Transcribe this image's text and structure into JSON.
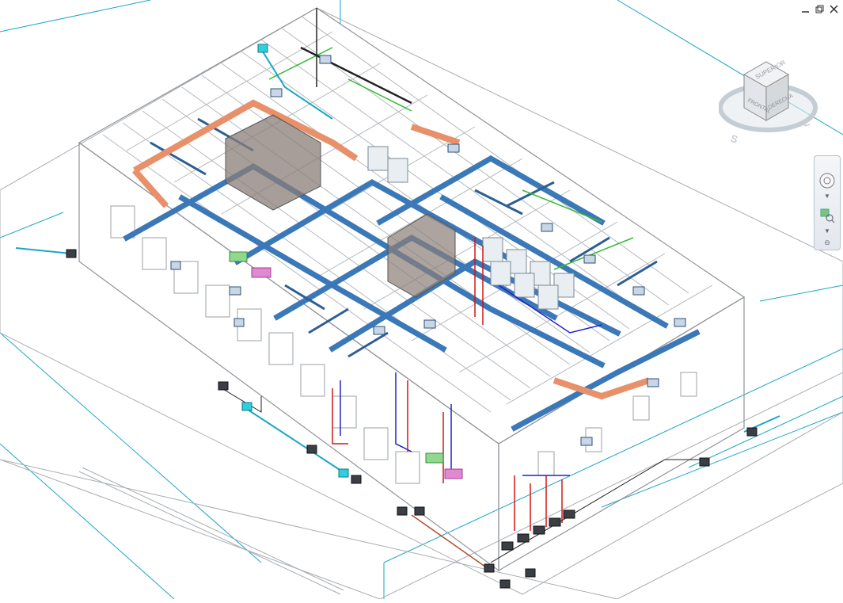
{
  "window": {
    "minimize_icon": "minimize-icon",
    "restore_icon": "restore-icon",
    "close_icon": "close-icon"
  },
  "viewcube": {
    "top_face": "SUPERIOR",
    "front_face": "FRONTAL",
    "right_face": "DERECHA",
    "compass_letter_s": "S",
    "compass_letter_e": "E"
  },
  "navigation_bar": {
    "items": [
      "steering-wheel-icon",
      "zoom-region-icon"
    ]
  },
  "colors": {
    "building_line": "#9aa0a6",
    "duct_blue": "#3b78b8",
    "duct_orange": "#e8906a",
    "pipe_red": "#d01818",
    "pipe_blue": "#2222c8",
    "pipe_green": "#38b838",
    "cyan_ref": "#1aa6c8",
    "equipment_gray": "#8a7d78"
  }
}
